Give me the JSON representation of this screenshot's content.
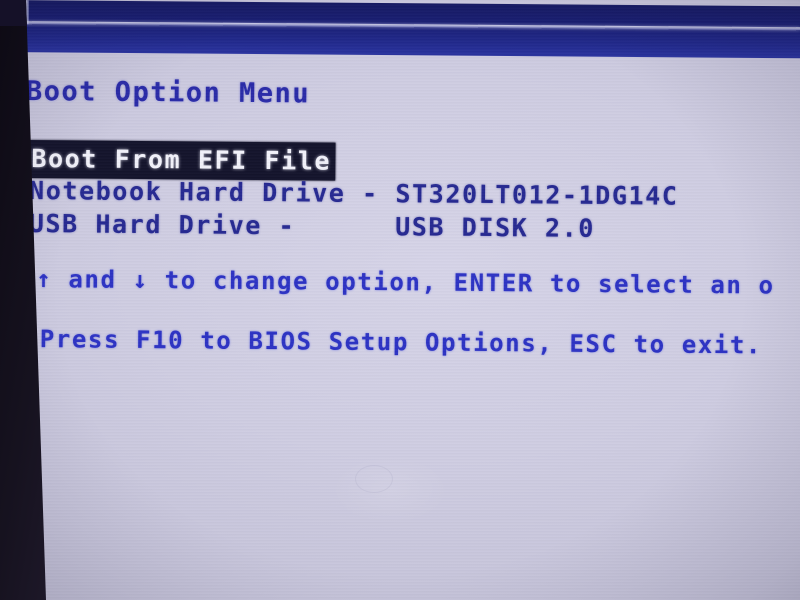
{
  "screen": {
    "kind": "bios-boot-option-menu",
    "title": "Boot Option Menu",
    "background_color": "#cfcde2",
    "banner_color": "#1f2585",
    "text_color": "#272a92",
    "hint_color": "#2d33c4",
    "highlight_bg_color": "#14142c",
    "highlight_fg_color": "#f2f2fa"
  },
  "boot_options": [
    {
      "label": "Boot From EFI File",
      "selected": true
    },
    {
      "label": "Notebook Hard Drive - ST320LT012-1DG14C",
      "selected": false
    },
    {
      "label": "USB Hard Drive -      USB DISK 2.0",
      "selected": false
    }
  ],
  "hints": [
    "↑ and ↓ to change option, ENTER to select an o",
    "Press F10 to BIOS Setup Options, ESC to exit."
  ],
  "keys": {
    "up_arrow": "↑",
    "down_arrow": "↓",
    "enter": "ENTER",
    "setup": "F10",
    "exit": "ESC"
  }
}
